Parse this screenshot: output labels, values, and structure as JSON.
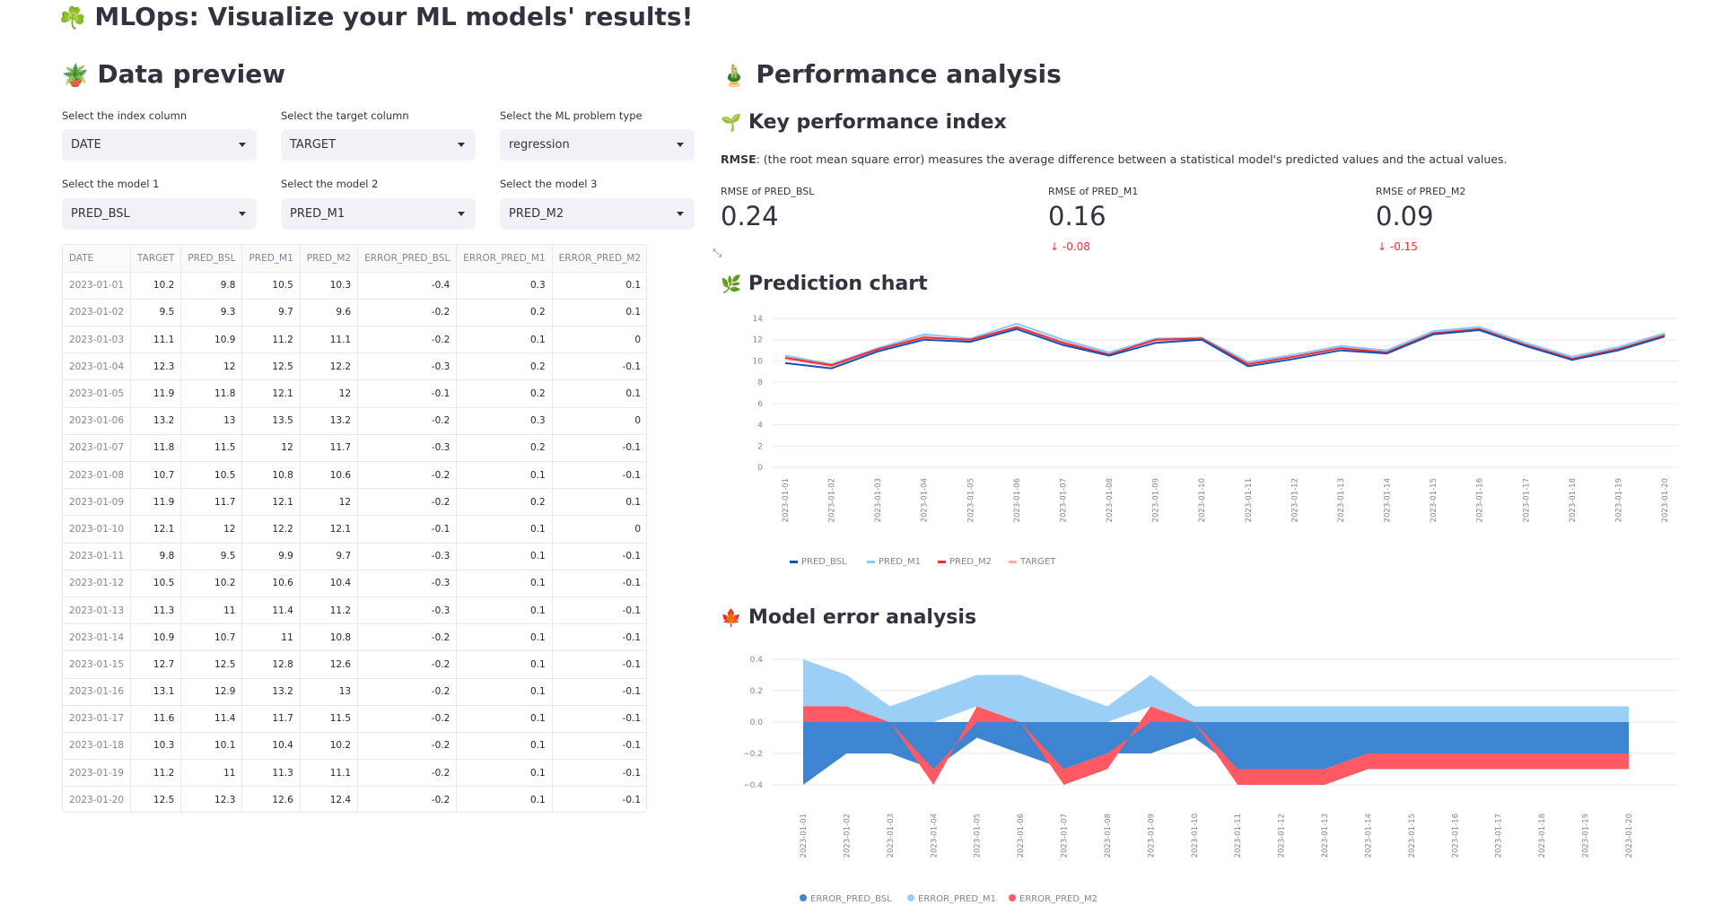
{
  "app": {
    "title": "MLOps: Visualize your ML models' results!",
    "title_emoji": "☘️"
  },
  "data_preview": {
    "heading": "Data preview",
    "heading_emoji": "🪴",
    "selects": [
      {
        "label": "Select the index column",
        "value": "DATE"
      },
      {
        "label": "Select the target column",
        "value": "TARGET"
      },
      {
        "label": "Select the ML problem type",
        "value": "regression"
      },
      {
        "label": "Select the model 1",
        "value": "PRED_BSL"
      },
      {
        "label": "Select the model 2",
        "value": "PRED_M1"
      },
      {
        "label": "Select the model 3",
        "value": "PRED_M2"
      }
    ],
    "table": {
      "columns": [
        "DATE",
        "TARGET",
        "PRED_BSL",
        "PRED_M1",
        "PRED_M2",
        "ERROR_PRED_BSL",
        "ERROR_PRED_M1",
        "ERROR_PRED_M2"
      ],
      "rows": [
        [
          "2023-01-01",
          "10.2",
          "9.8",
          "10.5",
          "10.3",
          "-0.4",
          "0.3",
          "0.1"
        ],
        [
          "2023-01-02",
          "9.5",
          "9.3",
          "9.7",
          "9.6",
          "-0.2",
          "0.2",
          "0.1"
        ],
        [
          "2023-01-03",
          "11.1",
          "10.9",
          "11.2",
          "11.1",
          "-0.2",
          "0.1",
          "0"
        ],
        [
          "2023-01-04",
          "12.3",
          "12",
          "12.5",
          "12.2",
          "-0.3",
          "0.2",
          "-0.1"
        ],
        [
          "2023-01-05",
          "11.9",
          "11.8",
          "12.1",
          "12",
          "-0.1",
          "0.2",
          "0.1"
        ],
        [
          "2023-01-06",
          "13.2",
          "13",
          "13.5",
          "13.2",
          "-0.2",
          "0.3",
          "0"
        ],
        [
          "2023-01-07",
          "11.8",
          "11.5",
          "12",
          "11.7",
          "-0.3",
          "0.2",
          "-0.1"
        ],
        [
          "2023-01-08",
          "10.7",
          "10.5",
          "10.8",
          "10.6",
          "-0.2",
          "0.1",
          "-0.1"
        ],
        [
          "2023-01-09",
          "11.9",
          "11.7",
          "12.1",
          "12",
          "-0.2",
          "0.2",
          "0.1"
        ],
        [
          "2023-01-10",
          "12.1",
          "12",
          "12.2",
          "12.1",
          "-0.1",
          "0.1",
          "0"
        ],
        [
          "2023-01-11",
          "9.8",
          "9.5",
          "9.9",
          "9.7",
          "-0.3",
          "0.1",
          "-0.1"
        ],
        [
          "2023-01-12",
          "10.5",
          "10.2",
          "10.6",
          "10.4",
          "-0.3",
          "0.1",
          "-0.1"
        ],
        [
          "2023-01-13",
          "11.3",
          "11",
          "11.4",
          "11.2",
          "-0.3",
          "0.1",
          "-0.1"
        ],
        [
          "2023-01-14",
          "10.9",
          "10.7",
          "11",
          "10.8",
          "-0.2",
          "0.1",
          "-0.1"
        ],
        [
          "2023-01-15",
          "12.7",
          "12.5",
          "12.8",
          "12.6",
          "-0.2",
          "0.1",
          "-0.1"
        ],
        [
          "2023-01-16",
          "13.1",
          "12.9",
          "13.2",
          "13",
          "-0.2",
          "0.1",
          "-0.1"
        ],
        [
          "2023-01-17",
          "11.6",
          "11.4",
          "11.7",
          "11.5",
          "-0.2",
          "0.1",
          "-0.1"
        ],
        [
          "2023-01-18",
          "10.3",
          "10.1",
          "10.4",
          "10.2",
          "-0.2",
          "0.1",
          "-0.1"
        ],
        [
          "2023-01-19",
          "11.2",
          "11",
          "11.3",
          "11.1",
          "-0.2",
          "0.1",
          "-0.1"
        ],
        [
          "2023-01-20",
          "12.5",
          "12.3",
          "12.6",
          "12.4",
          "-0.2",
          "0.1",
          "-0.1"
        ]
      ]
    }
  },
  "performance": {
    "heading": "Performance analysis",
    "heading_emoji": "🎍",
    "kpi": {
      "heading": "Key performance index",
      "heading_emoji": "🌱",
      "desc_bold": "RMSE",
      "desc_rest": ": (the root mean square error) measures the average difference between a statistical model's predicted values and the actual values.",
      "metrics": [
        {
          "label": "RMSE of PRED_BSL",
          "value": "0.24",
          "delta": ""
        },
        {
          "label": "RMSE of PRED_M1",
          "value": "0.16",
          "delta": "-0.08"
        },
        {
          "label": "RMSE of PRED_M2",
          "value": "0.09",
          "delta": "-0.15"
        }
      ]
    },
    "prediction_heading": "Prediction chart",
    "prediction_emoji": "🌿",
    "error_heading": "Model error analysis",
    "error_emoji": "🍁"
  },
  "colors": {
    "bsl": "#0f52ba",
    "m1": "#83c9ff",
    "m2": "#ff2b2b",
    "target": "#ffabab",
    "err_bsl": "#3d85d1",
    "err_m1": "#9ccff5",
    "err_m2": "#ff5a64"
  },
  "chart_data": [
    {
      "type": "line",
      "x": [
        "2023-01-01",
        "2023-01-02",
        "2023-01-03",
        "2023-01-04",
        "2023-01-05",
        "2023-01-06",
        "2023-01-07",
        "2023-01-08",
        "2023-01-09",
        "2023-01-10",
        "2023-01-11",
        "2023-01-12",
        "2023-01-13",
        "2023-01-14",
        "2023-01-15",
        "2023-01-16",
        "2023-01-17",
        "2023-01-18",
        "2023-01-19",
        "2023-01-20"
      ],
      "series": [
        {
          "name": "PRED_BSL",
          "values": [
            9.8,
            9.3,
            10.9,
            12,
            11.8,
            13,
            11.5,
            10.5,
            11.7,
            12,
            9.5,
            10.2,
            11,
            10.7,
            12.5,
            12.9,
            11.4,
            10.1,
            11,
            12.3
          ]
        },
        {
          "name": "PRED_M1",
          "values": [
            10.5,
            9.7,
            11.2,
            12.5,
            12.1,
            13.5,
            12,
            10.8,
            12.1,
            12.2,
            9.9,
            10.6,
            11.4,
            11,
            12.8,
            13.2,
            11.7,
            10.4,
            11.3,
            12.6
          ]
        },
        {
          "name": "PRED_M2",
          "values": [
            10.3,
            9.6,
            11.1,
            12.2,
            12,
            13.2,
            11.7,
            10.6,
            12,
            12.1,
            9.7,
            10.4,
            11.2,
            10.8,
            12.6,
            13,
            11.5,
            10.2,
            11.1,
            12.4
          ]
        },
        {
          "name": "TARGET",
          "values": [
            10.2,
            9.5,
            11.1,
            12.3,
            11.9,
            13.2,
            11.8,
            10.7,
            11.9,
            12.1,
            9.8,
            10.5,
            11.3,
            10.9,
            12.7,
            13.1,
            11.6,
            10.3,
            11.2,
            12.5
          ]
        }
      ],
      "yticks": [
        0,
        2,
        4,
        6,
        8,
        10,
        12,
        14
      ],
      "ylim": [
        0,
        14
      ],
      "legend": "bottom-left",
      "grid": true
    },
    {
      "type": "area",
      "x": [
        "2023-01-01",
        "2023-01-02",
        "2023-01-03",
        "2023-01-04",
        "2023-01-05",
        "2023-01-06",
        "2023-01-07",
        "2023-01-08",
        "2023-01-09",
        "2023-01-10",
        "2023-01-11",
        "2023-01-12",
        "2023-01-13",
        "2023-01-14",
        "2023-01-15",
        "2023-01-16",
        "2023-01-17",
        "2023-01-18",
        "2023-01-19",
        "2023-01-20"
      ],
      "series": [
        {
          "name": "ERROR_PRED_BSL",
          "values": [
            -0.4,
            -0.2,
            -0.2,
            -0.3,
            -0.1,
            -0.2,
            -0.3,
            -0.2,
            -0.2,
            -0.1,
            -0.3,
            -0.3,
            -0.3,
            -0.2,
            -0.2,
            -0.2,
            -0.2,
            -0.2,
            -0.2,
            -0.2
          ]
        },
        {
          "name": "ERROR_PRED_M1",
          "values": [
            0.3,
            0.2,
            0.1,
            0.2,
            0.2,
            0.3,
            0.2,
            0.1,
            0.2,
            0.1,
            0.1,
            0.1,
            0.1,
            0.1,
            0.1,
            0.1,
            0.1,
            0.1,
            0.1,
            0.1
          ]
        },
        {
          "name": "ERROR_PRED_M2",
          "values": [
            0.1,
            0.1,
            0,
            -0.1,
            0.1,
            0,
            -0.1,
            -0.1,
            0.1,
            0,
            -0.1,
            -0.1,
            -0.1,
            -0.1,
            -0.1,
            -0.1,
            -0.1,
            -0.1,
            -0.1,
            -0.1
          ]
        }
      ],
      "yticks": [
        "−0.4",
        "−0.2",
        "0.0",
        "0.2",
        "0.4"
      ],
      "ylim": [
        -0.4,
        0.4
      ],
      "stacked": "diverging",
      "legend": "bottom-left",
      "grid": true
    }
  ]
}
